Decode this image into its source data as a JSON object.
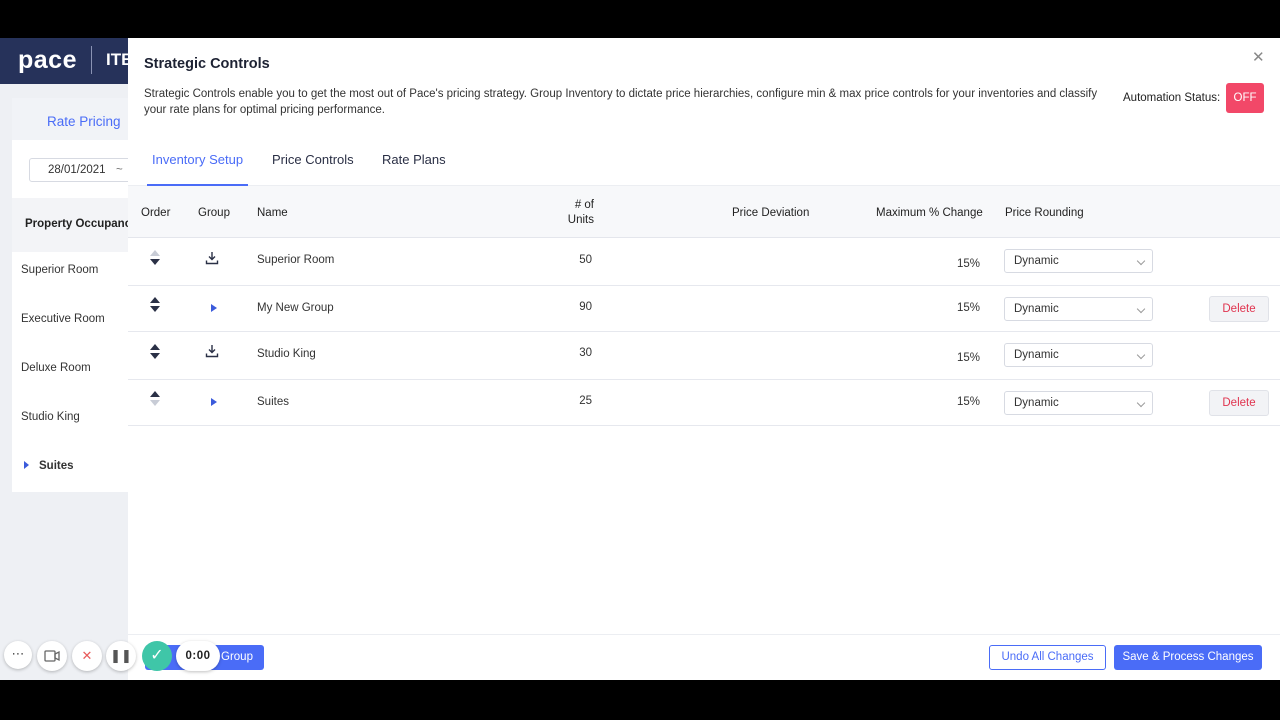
{
  "app": {
    "logo": "pace",
    "hotel_code": "ITB",
    "tab_rate_pricing": "Rate Pricing",
    "date_from": "28/01/2021",
    "date_sep": "~",
    "sidebar_heading": "Property Occupancy",
    "sidebar_rooms": [
      "Superior Room",
      "Executive Room",
      "Deluxe Room",
      "Studio King"
    ],
    "sidebar_suites": "Suites"
  },
  "modal": {
    "title": "Strategic Controls",
    "description": "Strategic Controls enable you to get the most out of Pace's pricing strategy. Group Inventory to dictate price hierarchies, configure min & max price controls for your inventories and classify your rate plans for optimal pricing performance.",
    "automation_label": "Automation Status:",
    "automation_value": "OFF",
    "tabs": [
      "Inventory Setup",
      "Price Controls",
      "Rate Plans"
    ],
    "active_tab": "Inventory Setup",
    "columns": {
      "order": "Order",
      "group": "Group",
      "name": "Name",
      "units": "# of Units",
      "price_deviation": "Price Deviation",
      "max_change": "Maximum % Change",
      "price_rounding": "Price Rounding"
    },
    "rows": [
      {
        "name": "Superior Room",
        "units": "50",
        "max_change": "15%",
        "rounding": "Dynamic",
        "type": "room",
        "delete": ""
      },
      {
        "name": "My New Group",
        "units": "90",
        "max_change": "15%",
        "rounding": "Dynamic",
        "type": "group",
        "delete": "Delete"
      },
      {
        "name": "Studio King",
        "units": "30",
        "max_change": "15%",
        "rounding": "Dynamic",
        "type": "room",
        "delete": ""
      },
      {
        "name": "Suites",
        "units": "25",
        "max_change": "15%",
        "rounding": "Dynamic",
        "type": "group",
        "delete": "Delete"
      }
    ],
    "footer": {
      "add_group": "Group",
      "undo": "Undo All Changes",
      "save": "Save & Process Changes"
    }
  },
  "recorder": {
    "time": "0:00"
  },
  "colors": {
    "accent": "#4a6cf7",
    "header": "#26325a",
    "off": "#f24868",
    "delete": "#e0344f"
  }
}
